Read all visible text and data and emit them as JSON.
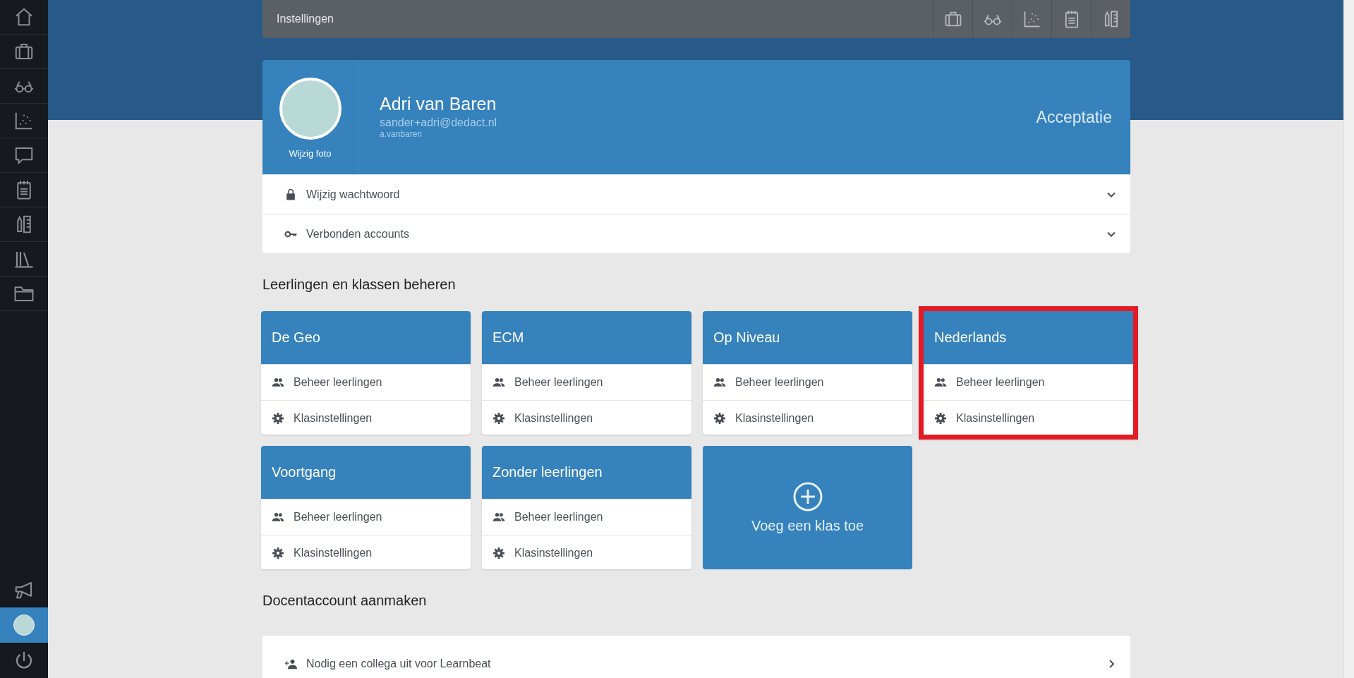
{
  "sidebar": {
    "items": [
      {
        "kind": "home",
        "selected": false
      },
      {
        "kind": "briefcase",
        "selected": false
      },
      {
        "kind": "glasses",
        "selected": false
      },
      {
        "kind": "chart",
        "selected": false
      },
      {
        "kind": "chat",
        "selected": false
      },
      {
        "kind": "notepad",
        "selected": false
      },
      {
        "kind": "ruler",
        "selected": false
      },
      {
        "kind": "books",
        "selected": false
      },
      {
        "kind": "folder",
        "selected": false
      }
    ],
    "bottom_items": [
      {
        "kind": "megaphone",
        "selected": false
      },
      {
        "kind": "avatar",
        "selected": true
      },
      {
        "kind": "power",
        "selected": false
      }
    ]
  },
  "top_bar": {
    "title": "Instellingen",
    "tools": [
      {
        "kind": "briefcase"
      },
      {
        "kind": "glasses"
      },
      {
        "kind": "chart"
      },
      {
        "kind": "notepad"
      },
      {
        "kind": "ruler"
      }
    ]
  },
  "profile": {
    "photo_label": "Wijzig foto",
    "name": "Adri van Baren",
    "email": "sander+adri@dedact.nl",
    "username": "a.vanbaren",
    "environment": "Acceptatie"
  },
  "settings_rows": [
    {
      "kind": "lock",
      "label": "Wijzig wachtwoord",
      "expanded": false
    },
    {
      "kind": "key",
      "label": "Verbonden accounts",
      "expanded": false
    }
  ],
  "classes_section": {
    "title": "Leerlingen en klassen beheren",
    "classes": [
      {
        "name": "De Geo",
        "highlighted": false,
        "actions": [
          {
            "kind": "students",
            "label": "Beheer leerlingen"
          },
          {
            "kind": "settings",
            "label": "Klasinstellingen"
          }
        ]
      },
      {
        "name": "ECM",
        "highlighted": false,
        "actions": [
          {
            "kind": "students",
            "label": "Beheer leerlingen"
          },
          {
            "kind": "settings",
            "label": "Klasinstellingen"
          }
        ]
      },
      {
        "name": "Op Niveau",
        "highlighted": false,
        "actions": [
          {
            "kind": "students",
            "label": "Beheer leerlingen"
          },
          {
            "kind": "settings",
            "label": "Klasinstellingen"
          }
        ]
      },
      {
        "name": "Nederlands",
        "highlighted": true,
        "actions": [
          {
            "kind": "students",
            "label": "Beheer leerlingen"
          },
          {
            "kind": "settings",
            "label": "Klasinstellingen"
          }
        ]
      },
      {
        "name": "Voortgang",
        "highlighted": false,
        "actions": [
          {
            "kind": "students",
            "label": "Beheer leerlingen"
          },
          {
            "kind": "settings",
            "label": "Klasinstellingen"
          }
        ]
      },
      {
        "name": "Zonder leerlingen",
        "highlighted": false,
        "actions": [
          {
            "kind": "students",
            "label": "Beheer leerlingen"
          },
          {
            "kind": "settings",
            "label": "Klasinstellingen"
          }
        ]
      }
    ],
    "add_label": "Voeg een klas toe"
  },
  "teacher_section": {
    "title": "Docentaccount aanmaken",
    "invite_label": "Nodig een collega uit voor Learnbeat"
  }
}
